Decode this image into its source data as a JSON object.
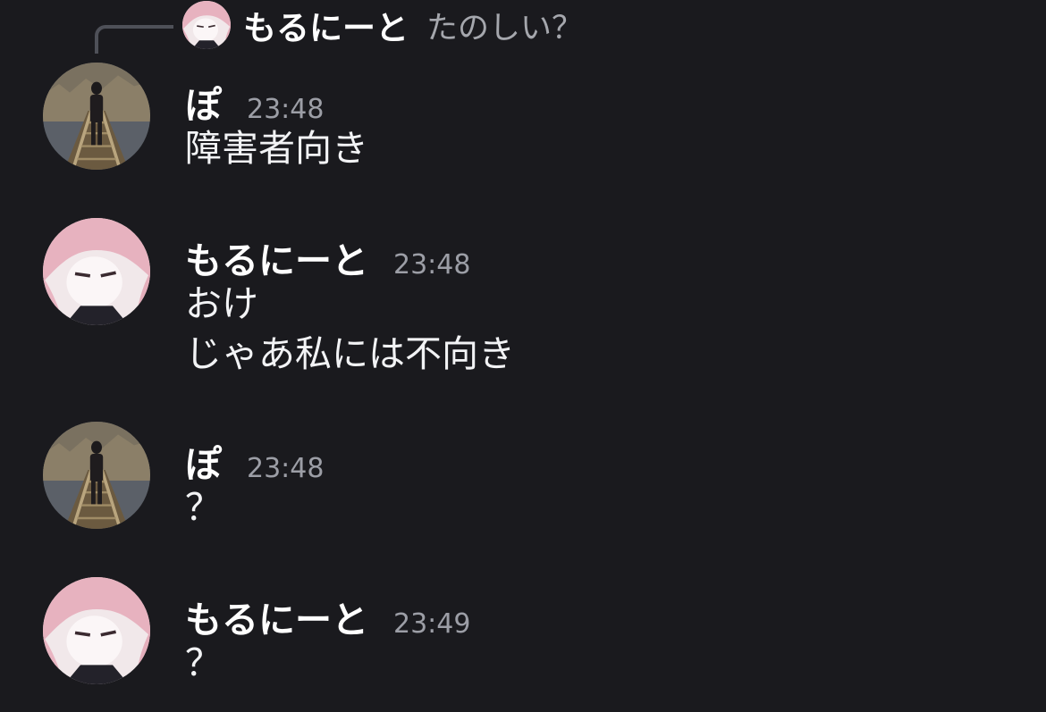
{
  "reply": {
    "author": "もるにーと",
    "text": "たのしい？",
    "avatar_icon": "pink-hair-anime-avatar-icon"
  },
  "messages": [
    {
      "author": "ぽ",
      "time": "23:48",
      "lines": [
        "障害者向き"
      ],
      "avatar_icon": "walking-figure-city-avatar-icon"
    },
    {
      "author": "もるにーと",
      "time": "23:48",
      "lines": [
        "おけ",
        "じゃあ私には不向き"
      ],
      "avatar_icon": "pink-hair-anime-avatar-icon"
    },
    {
      "author": "ぽ",
      "time": "23:48",
      "lines": [
        "？"
      ],
      "avatar_icon": "walking-figure-city-avatar-icon"
    },
    {
      "author": "もるにーと",
      "time": "23:49",
      "lines": [
        "？"
      ],
      "avatar_icon": "pink-hair-anime-avatar-icon"
    }
  ],
  "colors": {
    "background": "#1a1a1e",
    "text": "#f2f3f5",
    "muted": "#9c9ea6",
    "reply_line": "#4e5058"
  }
}
